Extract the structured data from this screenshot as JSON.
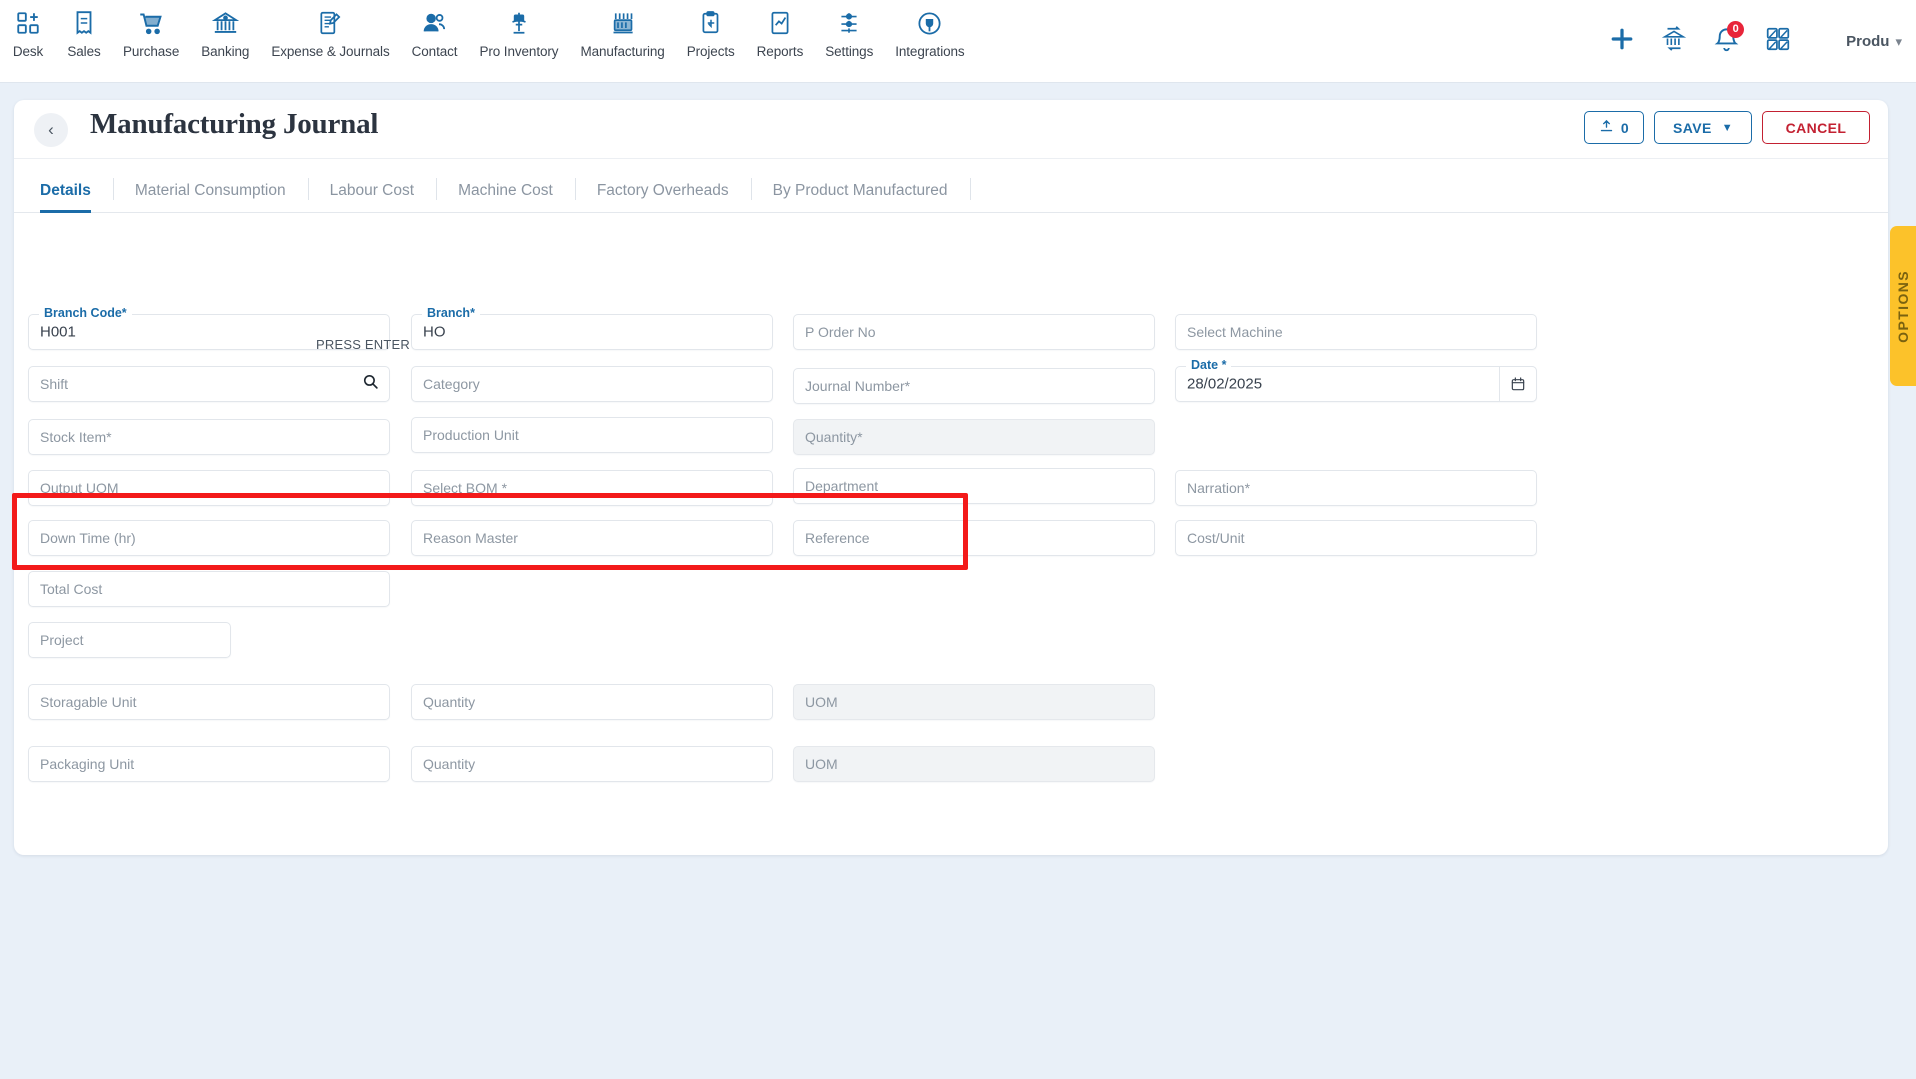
{
  "topnav": {
    "items": [
      {
        "label": "Desk",
        "icon": "desk-grid-plus-icon"
      },
      {
        "label": "Sales",
        "icon": "receipt-icon"
      },
      {
        "label": "Purchase",
        "icon": "shopping-cart-icon"
      },
      {
        "label": "Banking",
        "icon": "bank-icon"
      },
      {
        "label": "Expense & Journals",
        "icon": "notebook-pen-icon"
      },
      {
        "label": "Contact",
        "icon": "people-icon"
      },
      {
        "label": "Pro Inventory",
        "icon": "inventory-scale-icon"
      },
      {
        "label": "Manufacturing",
        "icon": "factory-machine-icon"
      },
      {
        "label": "Projects",
        "icon": "clipboard-import-icon"
      },
      {
        "label": "Reports",
        "icon": "report-chart-icon"
      },
      {
        "label": "Settings",
        "icon": "sliders-icon"
      },
      {
        "label": "Integrations",
        "icon": "plug-circle-icon"
      }
    ],
    "actions": {
      "add": "plus-icon",
      "bank_transfer": "bank-transfer-icon",
      "notifications": "bell-icon",
      "notification_count": "0",
      "apps": "grid-apps-icon"
    },
    "user": {
      "name": "Produ",
      "chevron": "chevron-down-icon"
    }
  },
  "header": {
    "back": "chevron-left-icon",
    "title": "Manufacturing Journal",
    "upload_label": "0",
    "upload_icon": "upload-icon",
    "save_label": "SAVE",
    "save_caret": "caret-down-icon",
    "cancel_label": "CANCEL"
  },
  "tabs": [
    {
      "label": "Details",
      "active": true
    },
    {
      "label": "Material Consumption",
      "active": false
    },
    {
      "label": "Labour Cost",
      "active": false
    },
    {
      "label": "Machine Cost",
      "active": false
    },
    {
      "label": "Factory Overheads",
      "active": false
    },
    {
      "label": "By Product Manufactured",
      "active": false
    }
  ],
  "form": {
    "press_enter_hint": "PRESS ENTER",
    "fields": {
      "branch_code": {
        "label": "Branch Code",
        "required": true,
        "value": "H001"
      },
      "branch": {
        "label": "Branch",
        "required": true,
        "value": "HO"
      },
      "p_order_no": {
        "placeholder": "P Order No"
      },
      "select_machine": {
        "placeholder": "Select Machine"
      },
      "shift": {
        "placeholder": "Shift",
        "icon": "search-icon"
      },
      "category": {
        "placeholder": "Category"
      },
      "journal_number": {
        "placeholder": "Journal Number",
        "required": true
      },
      "date": {
        "label": "Date",
        "required": true,
        "value": "28/02/2025",
        "icon": "calendar-icon"
      },
      "stock_item": {
        "placeholder": "Stock Item",
        "required": true
      },
      "production_unit": {
        "placeholder": "Production Unit"
      },
      "quantity_main": {
        "placeholder": "Quantity",
        "required": true,
        "disabled": true
      },
      "output_uom": {
        "placeholder": "Output UOM"
      },
      "select_bom": {
        "placeholder": "Select BOM",
        "required": true
      },
      "department": {
        "placeholder": "Department"
      },
      "narration": {
        "placeholder": "Narration",
        "required": true
      },
      "down_time": {
        "placeholder": "Down Time (hr)"
      },
      "reason_master": {
        "placeholder": "Reason Master"
      },
      "reference": {
        "placeholder": "Reference"
      },
      "cost_per_unit": {
        "placeholder": "Cost/Unit"
      },
      "total_cost": {
        "placeholder": "Total Cost"
      },
      "project": {
        "placeholder": "Project"
      },
      "storagable_unit": {
        "placeholder": "Storagable Unit"
      },
      "storagable_qty": {
        "placeholder": "Quantity"
      },
      "storagable_uom": {
        "placeholder": "UOM",
        "disabled": true
      },
      "packaging_unit": {
        "placeholder": "Packaging Unit"
      },
      "packaging_qty": {
        "placeholder": "Quantity"
      },
      "packaging_uom": {
        "placeholder": "UOM",
        "disabled": true
      }
    }
  },
  "options_panel": {
    "label": "OPTIONS"
  },
  "colors": {
    "accent": "#1b6ca8",
    "danger": "#c32132",
    "highlight": "#f31a1a",
    "options": "#fcc22a",
    "page_bg": "#e9f0f8"
  }
}
